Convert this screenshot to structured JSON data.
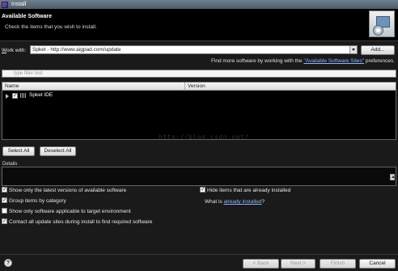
{
  "window": {
    "title": "Install"
  },
  "header": {
    "title": "Available Software",
    "description": "Check the items that you wish to install.",
    "banner_icon": "install-wizard-icon"
  },
  "work_with": {
    "label_prefix": "W",
    "label_rest": "ork with:",
    "value": "Spket - http://www.aigpad.com/update",
    "add_button": "Add...",
    "find_more_prefix": "Find more software by working with the ",
    "find_more_link": "\"Available Software Sites\"",
    "find_more_suffix": " preferences."
  },
  "filter": {
    "placeholder": "type filter text"
  },
  "table": {
    "columns": [
      "Name",
      "Version"
    ],
    "rows": [
      {
        "name": "Spket IDE",
        "version": "",
        "checked": true,
        "expandable": true
      }
    ]
  },
  "watermark": "http://blog.csdn.net/",
  "buttons": {
    "select_all": "Select All",
    "deselect_all": "Deselect All"
  },
  "details": {
    "label": "Details"
  },
  "options": [
    {
      "label": "Show only the latest versions of available software",
      "checked": true
    },
    {
      "label": "Group items by category",
      "checked": true
    },
    {
      "label": "Show only software applicable to target environment",
      "checked": false
    },
    {
      "label": "Contact all update sites during install to find required software",
      "checked": true
    },
    {
      "label": "Hide items that are already installed",
      "checked": true
    }
  ],
  "installed": {
    "prefix": "What is ",
    "link": "already installed",
    "suffix": "?"
  },
  "footer": {
    "back": "< Back",
    "next": "Next >",
    "finish": "Finish",
    "cancel": "Cancel",
    "help_glyph": "?"
  },
  "colors": {
    "link": "#8fb4ff",
    "titlebar": "#5c6d7b",
    "background": "#000000"
  }
}
